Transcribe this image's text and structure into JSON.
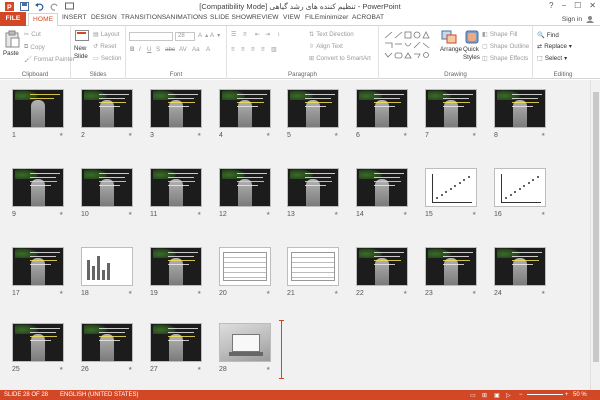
{
  "window": {
    "title": "[Compatibility Mode] تنظیم کننده های رشد گیاهی - PowerPoint",
    "controls": [
      "?",
      "−",
      "☐",
      "✕"
    ]
  },
  "tabs": {
    "file": "FILE",
    "items": [
      "HOME",
      "INSERT",
      "DESIGN",
      "TRANSITIONS",
      "ANIMATIONS",
      "SLIDE SHOW",
      "REVIEW",
      "VIEW",
      "FILEminimizer",
      "ACROBAT"
    ],
    "active": "HOME",
    "sign_in": "Sign in"
  },
  "ribbon": {
    "clipboard": {
      "label": "Clipboard",
      "paste": "Paste",
      "cut": "Cut",
      "copy": "Copy",
      "format_painter": "Format Painter"
    },
    "slides": {
      "label": "Slides",
      "new_slide": "New",
      "new_slide2": "Slide",
      "layout": "Layout",
      "reset": "Reset",
      "section": "Section"
    },
    "font": {
      "label": "Font",
      "size": "28"
    },
    "paragraph": {
      "label": "Paragraph",
      "text_direction": "Text Direction",
      "align_text": "Align Text",
      "convert_smartart": "Convert to SmartArt"
    },
    "drawing": {
      "label": "Drawing",
      "arrange": "Arrange",
      "quick_styles": "Quick",
      "quick_styles2": "Styles",
      "shape_fill": "Shape Fill",
      "shape_outline": "Shape Outline",
      "shape_effects": "Shape Effects"
    },
    "editing": {
      "label": "Editing",
      "find": "Find",
      "replace": "Replace",
      "select": "Select"
    }
  },
  "slides": [
    {
      "n": "1",
      "kind": "title"
    },
    {
      "n": "2",
      "kind": "text"
    },
    {
      "n": "3",
      "kind": "text"
    },
    {
      "n": "4",
      "kind": "text"
    },
    {
      "n": "5",
      "kind": "text"
    },
    {
      "n": "6",
      "kind": "text"
    },
    {
      "n": "7",
      "kind": "text"
    },
    {
      "n": "8",
      "kind": "text"
    },
    {
      "n": "9",
      "kind": "text"
    },
    {
      "n": "10",
      "kind": "text"
    },
    {
      "n": "11",
      "kind": "text"
    },
    {
      "n": "12",
      "kind": "text"
    },
    {
      "n": "13",
      "kind": "text"
    },
    {
      "n": "14",
      "kind": "text"
    },
    {
      "n": "15",
      "kind": "chart"
    },
    {
      "n": "16",
      "kind": "chart"
    },
    {
      "n": "17",
      "kind": "text"
    },
    {
      "n": "18",
      "kind": "bars"
    },
    {
      "n": "19",
      "kind": "text"
    },
    {
      "n": "20",
      "kind": "table"
    },
    {
      "n": "21",
      "kind": "table"
    },
    {
      "n": "22",
      "kind": "text"
    },
    {
      "n": "23",
      "kind": "text"
    },
    {
      "n": "24",
      "kind": "text"
    },
    {
      "n": "25",
      "kind": "text"
    },
    {
      "n": "26",
      "kind": "text"
    },
    {
      "n": "27",
      "kind": "text"
    },
    {
      "n": "28",
      "kind": "photo"
    }
  ],
  "status": {
    "slide_count": "SLIDE 28 OF 28",
    "language": "ENGLISH (UNITED STATES)",
    "zoom": "50 %"
  }
}
